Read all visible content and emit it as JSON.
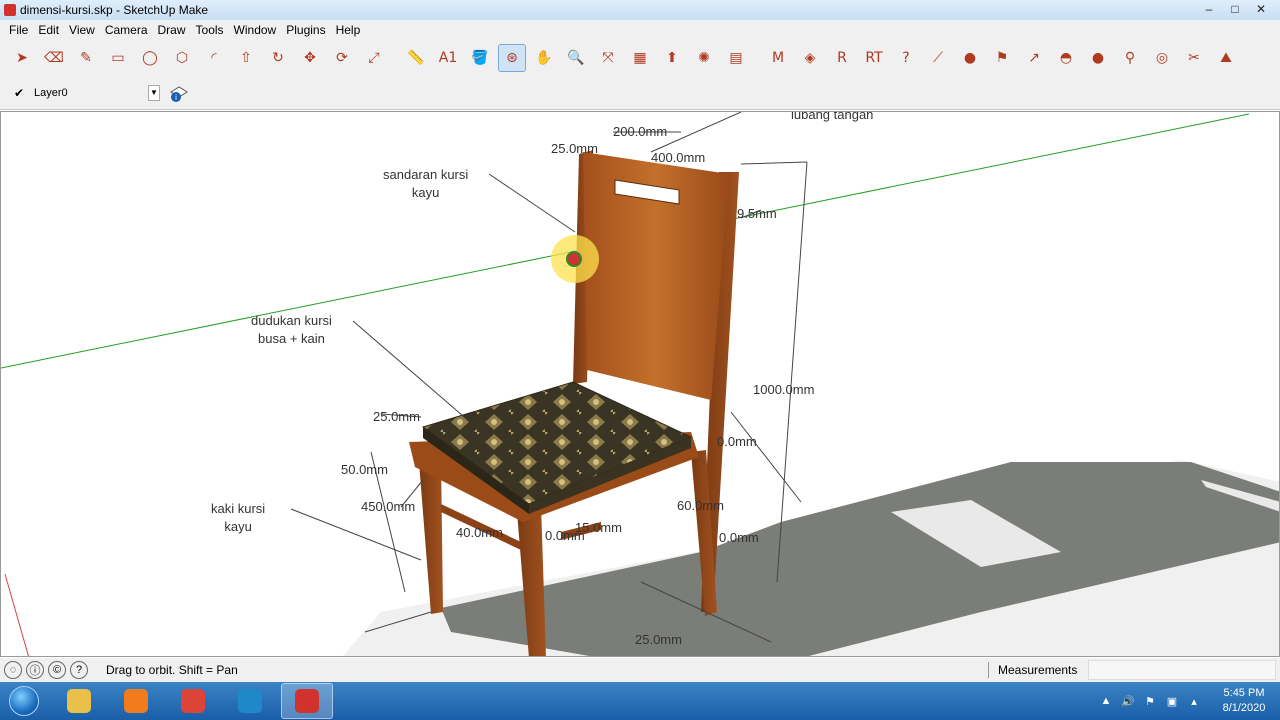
{
  "window": {
    "title": "dimensi-kursi.skp - SketchUp Make",
    "controls": [
      "–",
      "□",
      "✕"
    ]
  },
  "menu": [
    "File",
    "Edit",
    "View",
    "Camera",
    "Draw",
    "Tools",
    "Window",
    "Plugins",
    "Help"
  ],
  "toolbar": {
    "tools": [
      {
        "name": "select-icon",
        "glyph": "➤"
      },
      {
        "name": "eraser-icon",
        "glyph": "⌫"
      },
      {
        "name": "pencil-icon",
        "glyph": "✎"
      },
      {
        "name": "rectangle-icon",
        "glyph": "▭"
      },
      {
        "name": "circle-icon",
        "glyph": "◯"
      },
      {
        "name": "polygon-icon",
        "glyph": "⬡"
      },
      {
        "name": "arc-icon",
        "glyph": "◜"
      },
      {
        "name": "push-pull-icon",
        "glyph": "⇧"
      },
      {
        "name": "follow-me-icon",
        "glyph": "↻"
      },
      {
        "name": "move-icon",
        "glyph": "✥"
      },
      {
        "name": "rotate-icon",
        "glyph": "⟳"
      },
      {
        "name": "scale-icon",
        "glyph": "⤢"
      },
      {
        "name": "tape-measure-icon",
        "glyph": "📏"
      },
      {
        "name": "text-icon",
        "glyph": "A1"
      },
      {
        "name": "paint-bucket-icon",
        "glyph": "🪣"
      },
      {
        "name": "orbit-icon",
        "glyph": "⊛"
      },
      {
        "name": "pan-icon",
        "glyph": "✋"
      },
      {
        "name": "zoom-icon",
        "glyph": "🔍"
      },
      {
        "name": "zoom-extents-icon",
        "glyph": "⤧"
      },
      {
        "name": "warehouse-icon",
        "glyph": "▦"
      },
      {
        "name": "share-model-icon",
        "glyph": "⬆"
      },
      {
        "name": "extension-warehouse-icon",
        "glyph": "✺"
      },
      {
        "name": "layout-icon",
        "glyph": "▤"
      },
      {
        "name": "plugin-m-icon",
        "glyph": "M"
      },
      {
        "name": "plugin-tag-icon",
        "glyph": "◈"
      },
      {
        "name": "plugin-r-icon",
        "glyph": "R"
      },
      {
        "name": "plugin-rt-icon",
        "glyph": "RT"
      },
      {
        "name": "help-icon",
        "glyph": "?"
      },
      {
        "name": "plugin-ruler-icon",
        "glyph": "⟋"
      },
      {
        "name": "plugin-sphere-icon",
        "glyph": "●"
      },
      {
        "name": "plugin-flag-icon",
        "glyph": "⚑"
      },
      {
        "name": "plugin-arrow-icon",
        "glyph": "↗"
      },
      {
        "name": "plugin-dome-icon",
        "glyph": "◓"
      },
      {
        "name": "plugin-ball-icon",
        "glyph": "●"
      },
      {
        "name": "plugin-pin-icon",
        "glyph": "⚲"
      },
      {
        "name": "plugin-globe-icon",
        "glyph": "◎"
      },
      {
        "name": "plugin-scissors-icon",
        "glyph": "✂"
      },
      {
        "name": "plugin-landscape-icon",
        "glyph": "⛰"
      }
    ]
  },
  "layers": {
    "current": "Layer0",
    "check": "✔"
  },
  "dimensions": {
    "d1": "200.0mm",
    "d2": "25.0mm",
    "d3": "400.0mm",
    "d4": "9.5mm",
    "d5": "1000.0mm",
    "d6": "25.0mm",
    "d7": "50.0mm",
    "d8": "450.0mm",
    "d9": "40.0mm",
    "d10": "0.0mm",
    "d11": "60.0mm",
    "d12": "0.0mm",
    "d13": "25.0mm",
    "d14": "15.0mm",
    "d15": "0.0mm"
  },
  "notes": {
    "backrest": "sandaran kursi\nkayu",
    "seat": "dudukan kursi\nbusa + kain",
    "legs": "kaki kursi\nkayu",
    "handle": "lubang tangan"
  },
  "status": {
    "hint": "Drag to orbit.  Shift = Pan",
    "measurements_label": "Measurements"
  },
  "taskbar": {
    "apps": [
      {
        "name": "explorer-icon",
        "color": "#e8c04a"
      },
      {
        "name": "media-player-icon",
        "color": "#f07c1e"
      },
      {
        "name": "chrome-icon",
        "color": "#db4437"
      },
      {
        "name": "edge-icon",
        "color": "#1e88c9"
      },
      {
        "name": "sketchup-icon",
        "color": "#d2322d"
      }
    ],
    "time": "5:45 PM",
    "date": "8/1/2020"
  }
}
